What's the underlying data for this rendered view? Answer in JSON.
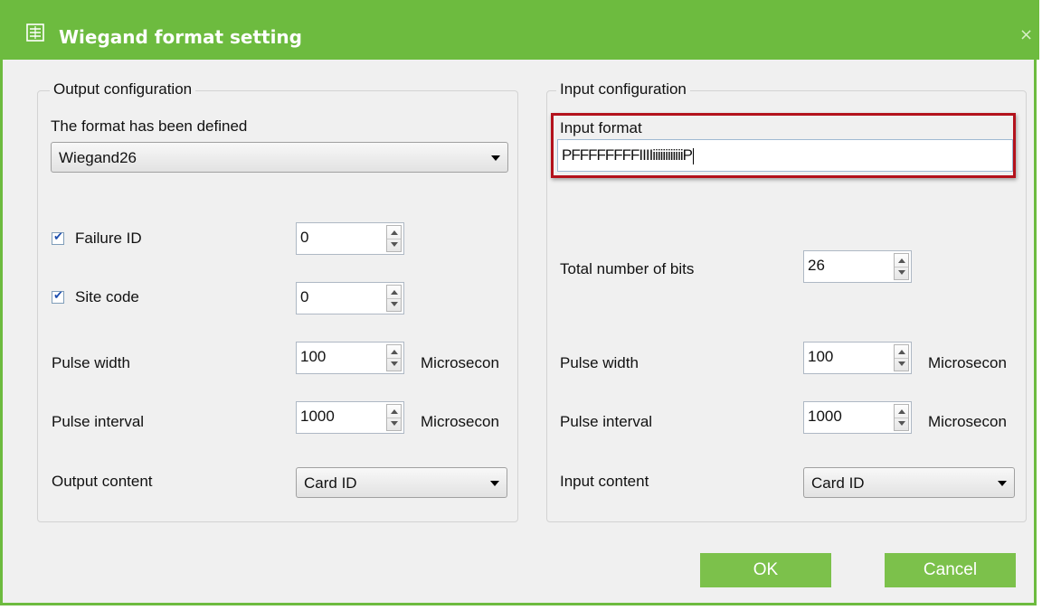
{
  "window": {
    "title": "Wiegand format setting",
    "close_glyph": "×",
    "accent_color": "#6dbb3f",
    "title_icon": "settings-grid-icon"
  },
  "output": {
    "legend": "Output configuration",
    "format_label": "The format has been defined",
    "format_value": "Wiegand26",
    "failure_id": {
      "label": "Failure ID",
      "checked": true,
      "value": "0"
    },
    "site_code": {
      "label": "Site code",
      "checked": true,
      "value": "0"
    },
    "pulse_width": {
      "label": "Pulse width",
      "value": "100",
      "unit": "Microsecon"
    },
    "pulse_interval": {
      "label": "Pulse interval",
      "value": "1000",
      "unit": "Microsecon"
    },
    "content": {
      "label": "Output content",
      "value": "Card ID"
    }
  },
  "input": {
    "legend": "Input configuration",
    "format_label": "Input format",
    "format_value": "PFFFFFFFFIIIIiiiiiiiiiiiiP",
    "total_bits": {
      "label": "Total number of bits",
      "value": "26"
    },
    "pulse_width": {
      "label": "Pulse width",
      "value": "100",
      "unit": "Microsecon"
    },
    "pulse_interval": {
      "label": "Pulse interval",
      "value": "1000",
      "unit": "Microsecon"
    },
    "content": {
      "label": "Input content",
      "value": "Card ID"
    }
  },
  "buttons": {
    "ok": "OK",
    "cancel": "Cancel"
  },
  "checkmark_glyph": "✔"
}
